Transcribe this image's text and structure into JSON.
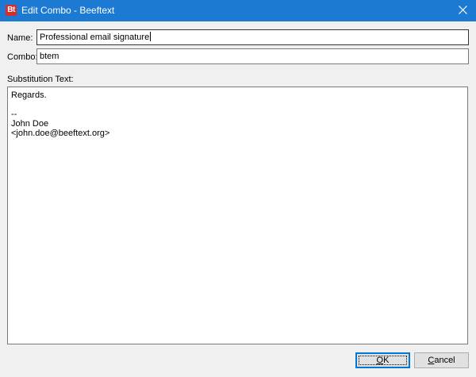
{
  "window": {
    "title": "Edit Combo - Beeftext",
    "app_icon_text": "Bt"
  },
  "form": {
    "name_label": "Name:",
    "name_value": "Professional email signature",
    "combo_label": "Combo:",
    "combo_value": "btem",
    "substitution_label": "Substitution Text:",
    "substitution_lines": [
      "Regards.",
      "",
      "--",
      "John Doe",
      "<john.doe@beeftext.org>"
    ]
  },
  "buttons": {
    "ok": {
      "mnemonic": "O",
      "rest": "K"
    },
    "cancel": {
      "mnemonic": "C",
      "rest": "ancel"
    }
  },
  "colors": {
    "titlebar": "#1c7ad3",
    "app_icon": "#d92b2b",
    "default_button_border": "#0078d7"
  }
}
